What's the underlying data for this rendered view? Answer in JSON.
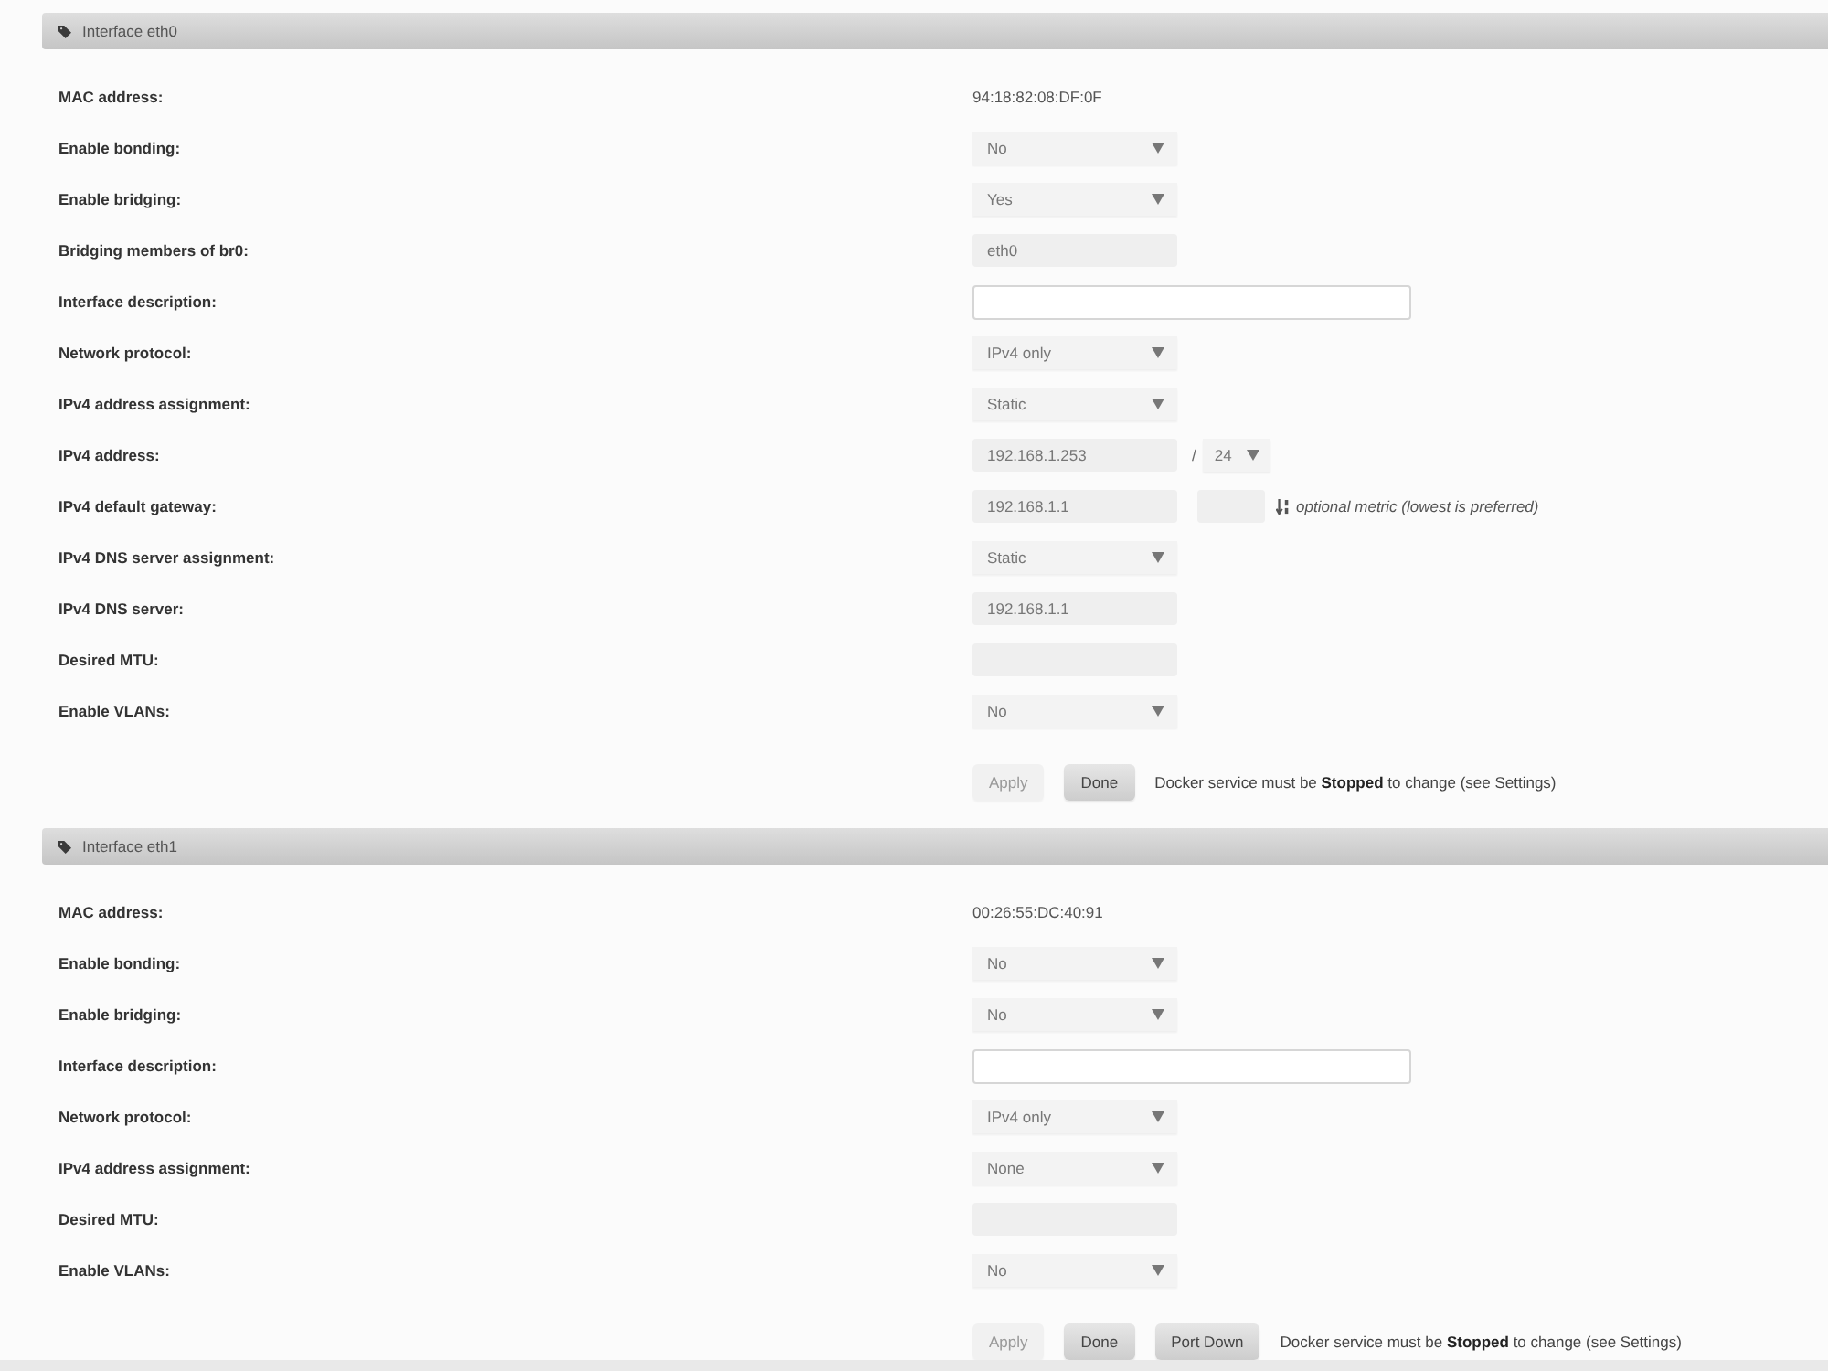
{
  "sections": [
    {
      "title": "Interface eth0",
      "fields": [
        {
          "label": "MAC address:",
          "kind": "text",
          "value": "94:18:82:08:DF:0F"
        },
        {
          "label": "Enable bonding:",
          "kind": "select",
          "value": "No"
        },
        {
          "label": "Enable bridging:",
          "kind": "select",
          "value": "Yes"
        },
        {
          "label": "Bridging members of br0:",
          "kind": "input",
          "value": "eth0"
        },
        {
          "label": "Interface description:",
          "kind": "wide-input"
        },
        {
          "label": "Network protocol:",
          "kind": "select",
          "value": "IPv4 only"
        },
        {
          "label": "IPv4 address assignment:",
          "kind": "select",
          "value": "Static"
        },
        {
          "label": "IPv4 address:",
          "kind": "address",
          "value": "192.168.1.253",
          "separator": "/",
          "prefix": "24"
        },
        {
          "label": "IPv4 default gateway:",
          "kind": "gateway",
          "value": "192.168.1.1",
          "hint": "optional metric (lowest is preferred)"
        },
        {
          "label": "IPv4 DNS server assignment:",
          "kind": "select",
          "value": "Static"
        },
        {
          "label": "IPv4 DNS server:",
          "kind": "input",
          "value": "192.168.1.1"
        },
        {
          "label": "Desired MTU:",
          "kind": "input"
        },
        {
          "label": "Enable VLANs:",
          "kind": "select",
          "value": "No"
        }
      ],
      "buttons": [
        {
          "label": "Apply",
          "disabled": true
        },
        {
          "label": "Done",
          "disabled": false
        }
      ],
      "note": "Docker service must be **Stopped** to change (see Settings)"
    },
    {
      "title": "Interface eth1",
      "fields": [
        {
          "label": "MAC address:",
          "kind": "text",
          "value": "00:26:55:DC:40:91"
        },
        {
          "label": "Enable bonding:",
          "kind": "select",
          "value": "No"
        },
        {
          "label": "Enable bridging:",
          "kind": "select",
          "value": "No"
        },
        {
          "label": "Interface description:",
          "kind": "wide-input"
        },
        {
          "label": "Network protocol:",
          "kind": "select",
          "value": "IPv4 only"
        },
        {
          "label": "IPv4 address assignment:",
          "kind": "select",
          "value": "None"
        },
        {
          "label": "Desired MTU:",
          "kind": "input"
        },
        {
          "label": "Enable VLANs:",
          "kind": "select",
          "value": "No"
        }
      ],
      "buttons": [
        {
          "label": "Apply",
          "disabled": true
        },
        {
          "label": "Done",
          "disabled": false
        },
        {
          "label": "Port Down",
          "disabled": false
        }
      ],
      "note": "Docker service must be **Stopped** to change (see Settings)"
    }
  ]
}
